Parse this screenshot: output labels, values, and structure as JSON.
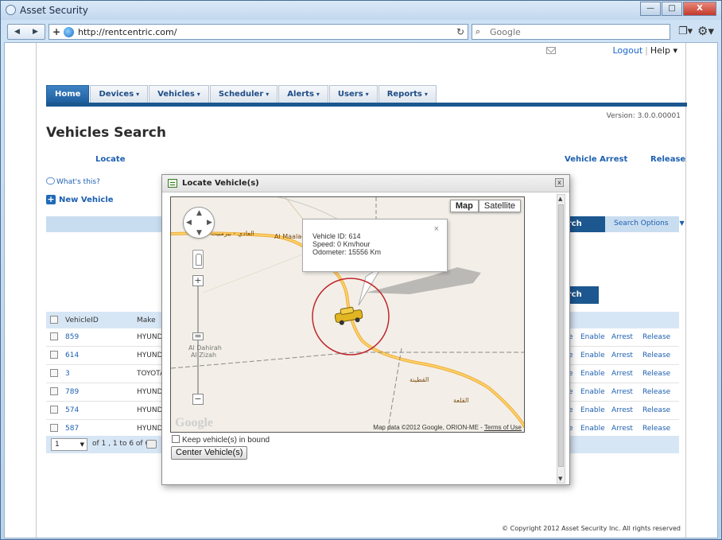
{
  "browser": {
    "window_title": "Asset Security",
    "url": "http://rentcentric.com/",
    "search_placeholder": "Google",
    "window_buttons": {
      "minimize": "—",
      "maximize": "□",
      "close": "X"
    }
  },
  "header": {
    "logout": "Logout",
    "separator": "|",
    "help": "Help"
  },
  "menu": [
    {
      "label": "Home",
      "caret": ""
    },
    {
      "label": "Devices",
      "caret": "▾"
    },
    {
      "label": "Vehicles",
      "caret": "▾"
    },
    {
      "label": "Scheduler",
      "caret": "▾"
    },
    {
      "label": "Alerts",
      "caret": "▾"
    },
    {
      "label": "Users",
      "caret": "▾"
    },
    {
      "label": "Reports",
      "caret": "▾"
    }
  ],
  "page": {
    "version": "Version: 3.0.0.00001",
    "title": "Vehicles Search",
    "actions": {
      "locate": "Locate",
      "vehicle_arrest": "Vehicle Arrest",
      "release": "Release"
    },
    "whats_this": "What's this?",
    "new_vehicle": "New Vehicle",
    "search_top": "arch",
    "search_options": "Search Options",
    "search_bottom": "arch",
    "copyright": "© Copyright 2012 Asset Security Inc. All rights reserved"
  },
  "grid": {
    "headers": {
      "vehicle_id": "VehicleID",
      "make": "Make"
    },
    "rows": [
      {
        "id": "859",
        "make": "HYUNDA",
        "a0": "e",
        "a1": "Enable",
        "a2": "Arrest",
        "a3": "Release"
      },
      {
        "id": "614",
        "make": "HYUNDA",
        "a0": "e",
        "a1": "Enable",
        "a2": "Arrest",
        "a3": "Release"
      },
      {
        "id": "3",
        "make": "TOYOTA",
        "a0": "e",
        "a1": "Enable",
        "a2": "Arrest",
        "a3": "Release"
      },
      {
        "id": "789",
        "make": "HYUNDA",
        "a0": "e",
        "a1": "Enable",
        "a2": "Arrest",
        "a3": "Release"
      },
      {
        "id": "574",
        "make": "HYUNDA",
        "a0": "e",
        "a1": "Enable",
        "a2": "Arrest",
        "a3": "Release"
      },
      {
        "id": "587",
        "make": "HYUNDA",
        "a0": "e",
        "a1": "Enable",
        "a2": "Arrest",
        "a3": "Release"
      }
    ],
    "pager": {
      "page": "1",
      "summary": "of 1 , 1 to 6 of 6"
    }
  },
  "modal": {
    "title": "Locate Vehicle(s)",
    "map_button": "Map",
    "satellite_button": "Satellite",
    "info": {
      "vehicle_id": "Vehicle ID: 614",
      "speed": "Speed: 0 Km/hour",
      "odometer": "Odometer: 15556 Km",
      "close": "×"
    },
    "google_logo": "Google",
    "map_data": "Map data ©2012 Google, ORION-ME -",
    "terms": "Terms of Use",
    "place_1": "Al Dahirah",
    "place_2": "Al Zizah",
    "keep_in_bound": "Keep vehicle(s) in bound",
    "center_button": "Center Vehicle(s)"
  },
  "colors": {
    "nav_blue": "#1c5790",
    "link_blue": "#1d5fb0",
    "grid_header": "#d7e6f5",
    "road": "#f5b942",
    "marker_ring": "#c0272d"
  }
}
